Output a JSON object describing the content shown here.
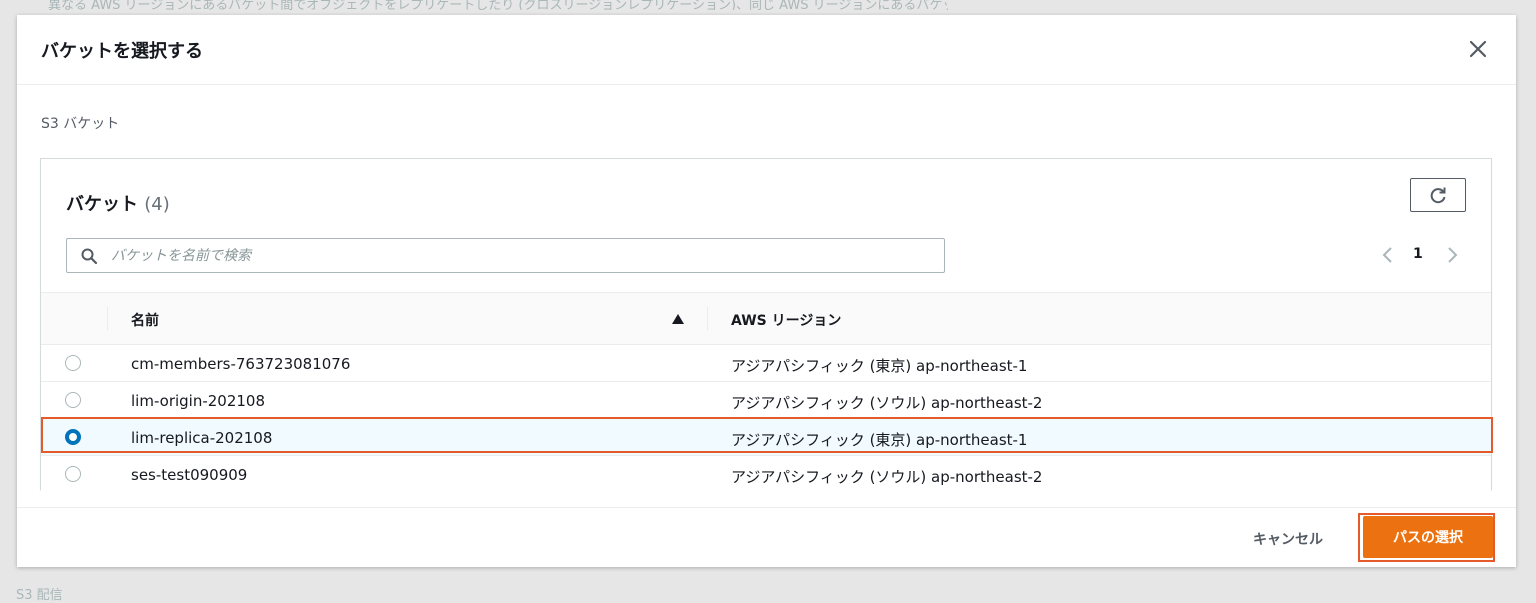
{
  "background": {
    "top_text": "異なる AWS リージョンにあるバケット間でオブジェクトをレプリケートしたり (クロスリージョンレプリケーション)、同じ AWS リージョンにあるバケット間で",
    "bottom_text": "S3 配信"
  },
  "modal": {
    "title": "バケットを選択する",
    "section_label": "S3 バケット"
  },
  "panel": {
    "title": "バケット",
    "count": "(4)",
    "search_placeholder": "バケットを名前で検索",
    "page_number": "1"
  },
  "table": {
    "columns": {
      "name": "名前",
      "region": "AWS リージョン"
    },
    "rows": [
      {
        "name": "cm-members-763723081076",
        "region": "アジアパシフィック (東京) ap-northeast-1",
        "selected": false
      },
      {
        "name": "lim-origin-202108",
        "region": "アジアパシフィック (ソウル) ap-northeast-2",
        "selected": false
      },
      {
        "name": "lim-replica-202108",
        "region": "アジアパシフィック (東京) ap-northeast-1",
        "selected": true
      },
      {
        "name": "ses-test090909",
        "region": "アジアパシフィック (ソウル) ap-northeast-2",
        "selected": false
      }
    ]
  },
  "footer": {
    "cancel_label": "キャンセル",
    "select_label": "パスの選択"
  },
  "colors": {
    "primary_button": "#ec7211",
    "selected_radio": "#0073bb",
    "highlight_annotation": "#e55a2b"
  },
  "icons": [
    "close-icon",
    "refresh-icon",
    "search-icon",
    "chevron-left-icon",
    "chevron-right-icon",
    "sort-ascending-icon"
  ]
}
